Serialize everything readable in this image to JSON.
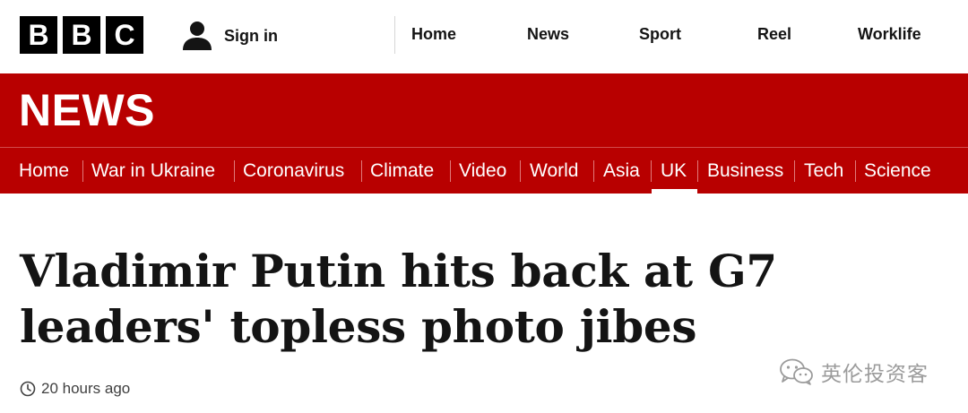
{
  "brand": {
    "logo_letters": [
      "B",
      "B",
      "C"
    ],
    "logo_name": "BBC"
  },
  "header": {
    "signin_label": "Sign in",
    "signin_icon": "user-icon",
    "nav": [
      "Home",
      "News",
      "Sport",
      "Reel",
      "Worklife"
    ]
  },
  "section_banner": {
    "title": "NEWS"
  },
  "section_nav": {
    "items": [
      "Home",
      "War in Ukraine",
      "Coronavirus",
      "Climate",
      "Video",
      "World",
      "Asia",
      "UK",
      "Business",
      "Tech",
      "Science"
    ],
    "active": "UK"
  },
  "article": {
    "headline_line1": "Vladimir Putin hits back at G7",
    "headline_line2": "leaders' topless photo jibes",
    "timestamp": "20 hours ago",
    "timestamp_icon": "clock-icon"
  },
  "watermark": {
    "text": "英伦投资客",
    "icon": "wechat-icon"
  },
  "colors": {
    "brand_red": "#b80000",
    "logo_black": "#000000",
    "text": "#141414"
  }
}
